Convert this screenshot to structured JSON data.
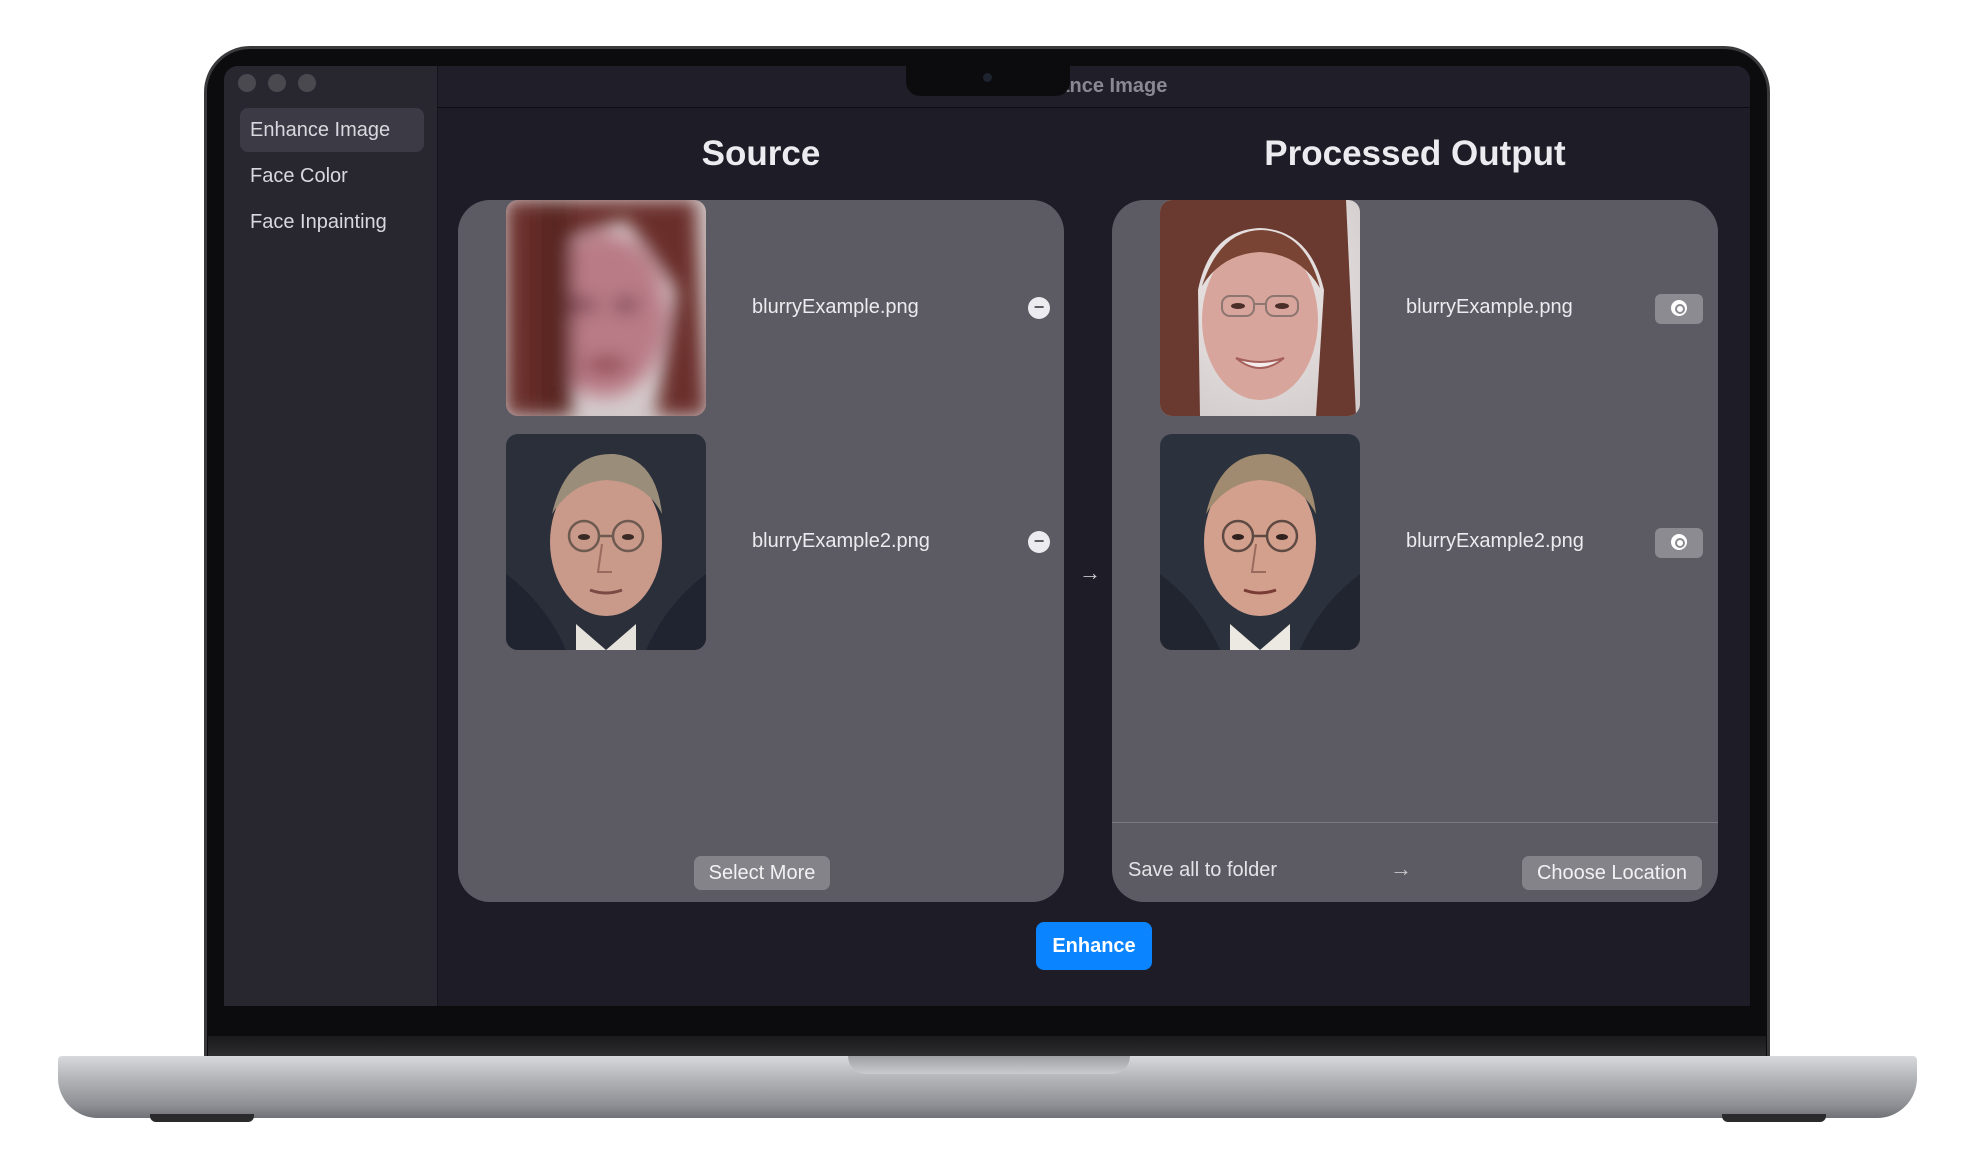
{
  "window": {
    "title": "Enhance Image"
  },
  "sidebar": {
    "items": [
      {
        "label": "Enhance Image",
        "active": true
      },
      {
        "label": "Face Color",
        "active": false
      },
      {
        "label": "Face Inpainting",
        "active": false
      }
    ]
  },
  "source": {
    "title": "Source",
    "files": [
      {
        "name": "blurryExample.png",
        "action_icon": "minus-circle-icon"
      },
      {
        "name": "blurryExample2.png",
        "action_icon": "minus-circle-icon"
      }
    ],
    "select_more_label": "Select More"
  },
  "output": {
    "title": "Processed Output",
    "files": [
      {
        "name": "blurryExample.png",
        "action_icon": "magnifier-icon"
      },
      {
        "name": "blurryExample2.png",
        "action_icon": "magnifier-icon"
      }
    ],
    "save_all_label": "Save all to folder",
    "choose_location_label": "Choose Location"
  },
  "enhance_label": "Enhance",
  "colors": {
    "accent": "#0a84ff",
    "panel": "#5c5a62",
    "background": "#1e1c26"
  }
}
